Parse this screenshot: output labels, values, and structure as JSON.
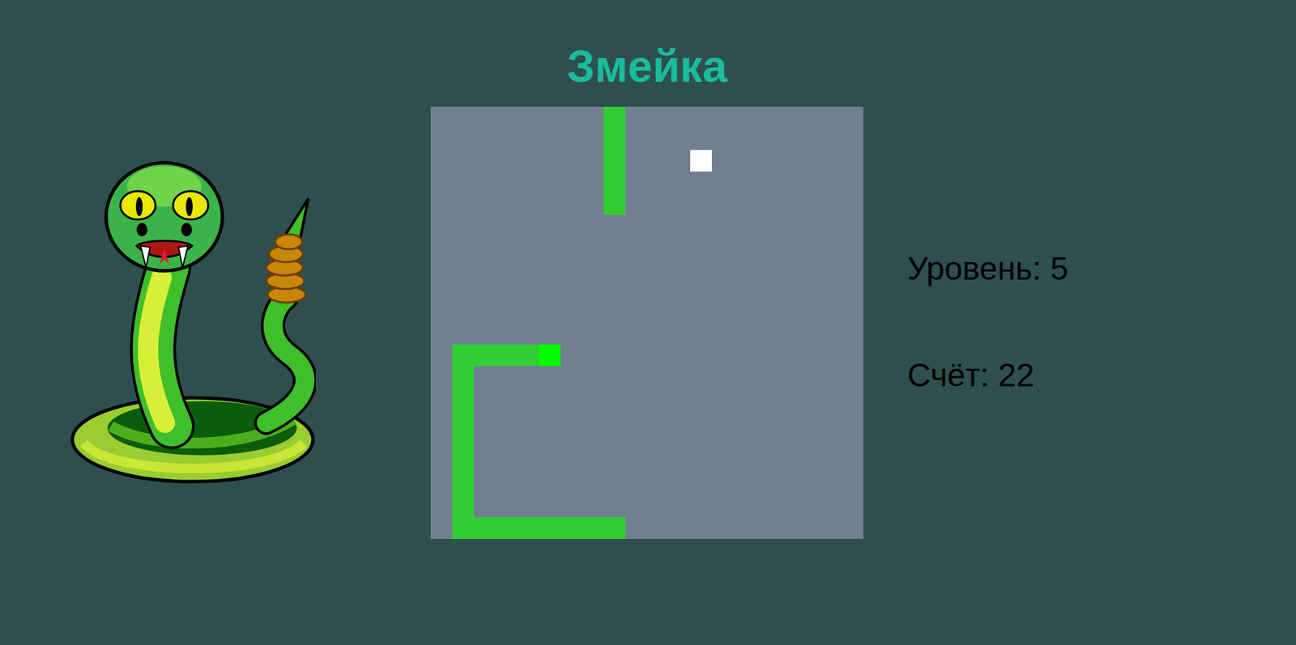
{
  "title": "Змейка",
  "level": "Уровень: 5",
  "score": "Счёт: 22",
  "board": {
    "cols": 20,
    "rows": 20,
    "food": {
      "x": 12,
      "y": 2
    },
    "snake": [
      {
        "x": 5,
        "y": 11,
        "kind": "head"
      },
      {
        "x": 4,
        "y": 11,
        "kind": "body"
      },
      {
        "x": 3,
        "y": 11,
        "kind": "body"
      },
      {
        "x": 2,
        "y": 11,
        "kind": "body"
      },
      {
        "x": 1,
        "y": 11,
        "kind": "body"
      },
      {
        "x": 1,
        "y": 12,
        "kind": "body"
      },
      {
        "x": 1,
        "y": 13,
        "kind": "body"
      },
      {
        "x": 1,
        "y": 14,
        "kind": "body"
      },
      {
        "x": 1,
        "y": 15,
        "kind": "body"
      },
      {
        "x": 1,
        "y": 16,
        "kind": "body"
      },
      {
        "x": 1,
        "y": 17,
        "kind": "body"
      },
      {
        "x": 1,
        "y": 18,
        "kind": "body"
      },
      {
        "x": 1,
        "y": 19,
        "kind": "body"
      },
      {
        "x": 2,
        "y": 19,
        "kind": "body"
      },
      {
        "x": 3,
        "y": 19,
        "kind": "body"
      },
      {
        "x": 4,
        "y": 19,
        "kind": "body"
      },
      {
        "x": 5,
        "y": 19,
        "kind": "body"
      },
      {
        "x": 6,
        "y": 19,
        "kind": "body"
      },
      {
        "x": 7,
        "y": 19,
        "kind": "body"
      },
      {
        "x": 8,
        "y": 19,
        "kind": "body"
      },
      {
        "x": 8,
        "y": 0,
        "kind": "body"
      },
      {
        "x": 8,
        "y": 1,
        "kind": "body"
      },
      {
        "x": 8,
        "y": 2,
        "kind": "body"
      },
      {
        "x": 8,
        "y": 3,
        "kind": "body"
      },
      {
        "x": 8,
        "y": 4,
        "kind": "body"
      }
    ]
  }
}
